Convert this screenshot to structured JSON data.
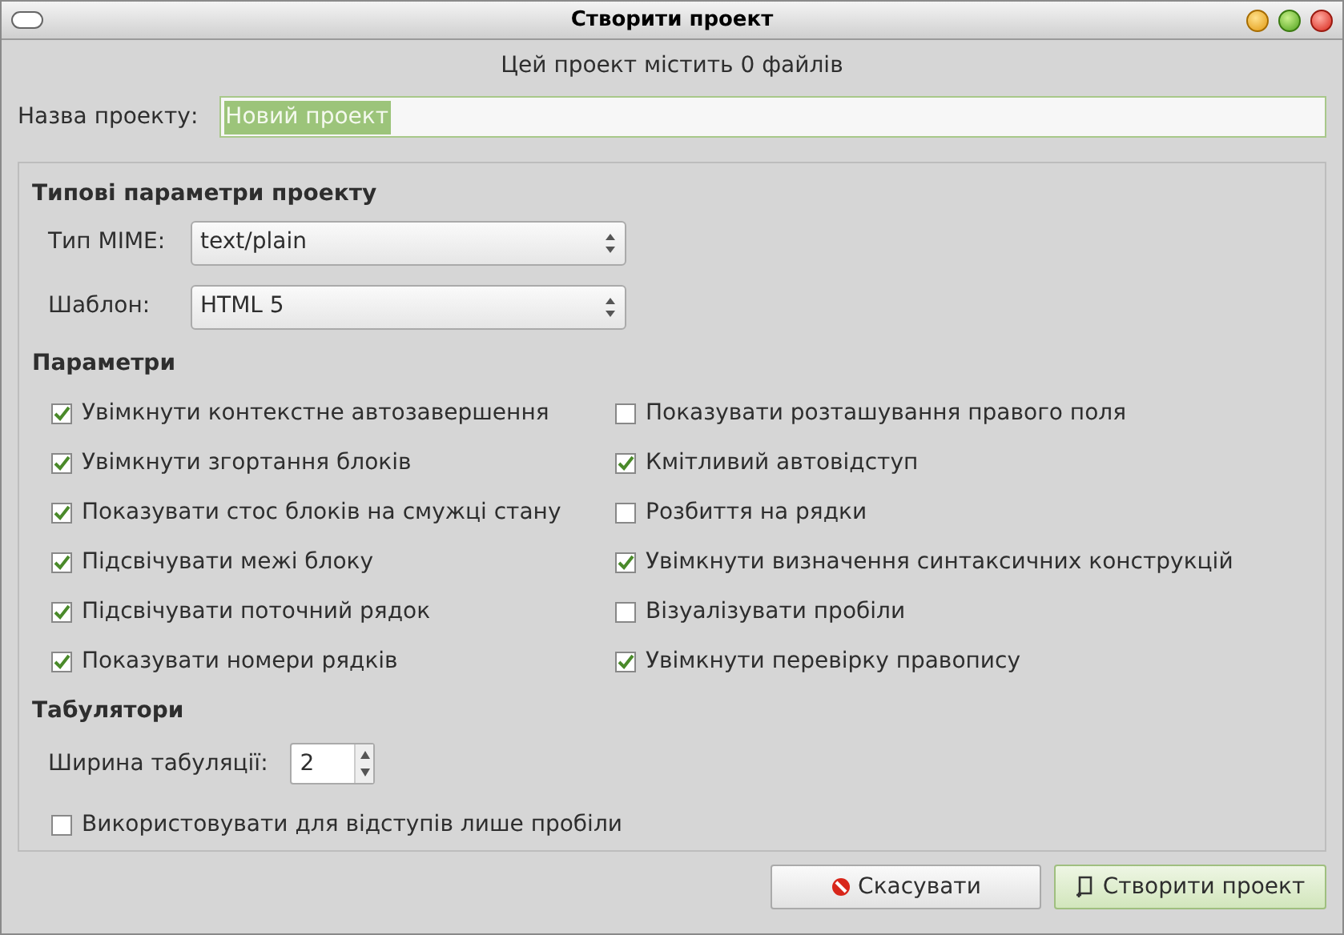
{
  "window": {
    "title": "Створити проект"
  },
  "info": "Цей проект містить 0 файлів",
  "project_name": {
    "label": "Назва проекту:",
    "value": "Новий проект",
    "text_selected": true
  },
  "defaults": {
    "heading": "Типові параметри проекту",
    "fields": [
      {
        "label": "Тип MIME:",
        "value": "text/plain"
      },
      {
        "label": "Шаблон:",
        "value": "HTML 5"
      }
    ]
  },
  "options": {
    "heading": "Параметри",
    "columns": [
      [
        {
          "label": "Увімкнути контекстне автозавершення",
          "checked": true
        },
        {
          "label": "Увімкнути згортання блоків",
          "checked": true
        },
        {
          "label": "Показувати стос блоків на смужці стану",
          "checked": true
        },
        {
          "label": "Підсвічувати межі блоку",
          "checked": true
        },
        {
          "label": "Підсвічувати поточний рядок",
          "checked": true
        },
        {
          "label": "Показувати номери рядків",
          "checked": true
        }
      ],
      [
        {
          "label": "Показувати розташування правого поля",
          "checked": false
        },
        {
          "label": "Кмітливий автовідступ",
          "checked": true
        },
        {
          "label": "Розбиття на рядки",
          "checked": false
        },
        {
          "label": "Увімкнути визначення синтаксичних конструкцій",
          "checked": true
        },
        {
          "label": "Візуалізувати пробіли",
          "checked": false
        },
        {
          "label": "Увімкнути перевірку правопису",
          "checked": true
        }
      ]
    ]
  },
  "tabs": {
    "heading": "Табулятори",
    "width_label": "Ширина табуляції:",
    "width_value": "2",
    "spaces": {
      "label": "Використовувати для відступів лише пробіли",
      "checked": false
    }
  },
  "buttons": [
    {
      "kind": "cancel",
      "label": "Скасувати",
      "default": false
    },
    {
      "kind": "create",
      "label": "Створити проект",
      "default": true
    }
  ]
}
